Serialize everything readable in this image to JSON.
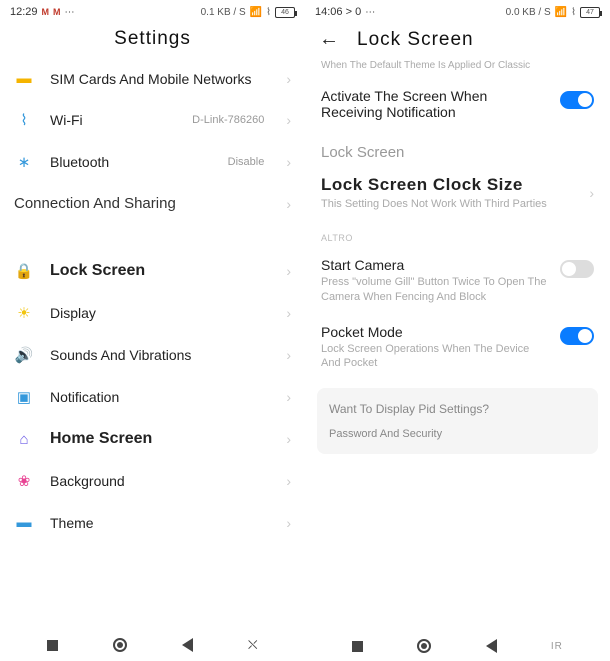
{
  "left": {
    "status": {
      "time": "12:29",
      "data": "0.1 KB / S",
      "battery": "46"
    },
    "title": "Settings",
    "items": [
      {
        "icon": "▬",
        "cls": "c-sim",
        "label": "SIM Cards And Mobile Networks",
        "value": ""
      },
      {
        "icon": "⌇",
        "cls": "c-wifi",
        "label": "Wi-Fi",
        "value": "D-Link-786260"
      },
      {
        "icon": "∗",
        "cls": "c-bt",
        "label": "Bluetooth",
        "value": "Disable"
      }
    ],
    "section": "Connection And Sharing",
    "items2": [
      {
        "icon": "🔒",
        "cls": "c-lock",
        "label": "Lock Screen",
        "bold": true
      },
      {
        "icon": "☀",
        "cls": "c-disp",
        "label": "Display"
      },
      {
        "icon": "🔊",
        "cls": "c-sound",
        "label": "Sounds And Vibrations"
      },
      {
        "icon": "▣",
        "cls": "c-notif",
        "label": "Notification"
      },
      {
        "icon": "⌂",
        "cls": "c-home",
        "label": "Home Screen",
        "bold": true
      },
      {
        "icon": "❀",
        "cls": "c-bg",
        "label": "Background"
      },
      {
        "icon": "▬",
        "cls": "c-theme",
        "label": "Theme"
      }
    ]
  },
  "right": {
    "status": {
      "time": "14:06 > 0",
      "data": "0.0 KB / S",
      "battery": "47"
    },
    "title": "Lock Screen",
    "subtitle": "When The Default Theme Is Applied Or Classic",
    "wake_title": "Activate The Screen When Receiving Notification",
    "section": "Lock Screen",
    "clock_title": "Lock Screen Clock Size",
    "clock_desc": "This Setting Does Not Work With Third Parties",
    "altro": "ALTRO",
    "camera_title": "Start Camera",
    "camera_desc": "Press \"volume Gill\" Button Twice To Open The Camera When Fencing And Block",
    "pocket_title": "Pocket Mode",
    "pocket_desc": "Lock Screen Operations When The Device And Pocket",
    "info_title": "Want To Display Pid Settings?",
    "info_sub": "Password And Security"
  }
}
